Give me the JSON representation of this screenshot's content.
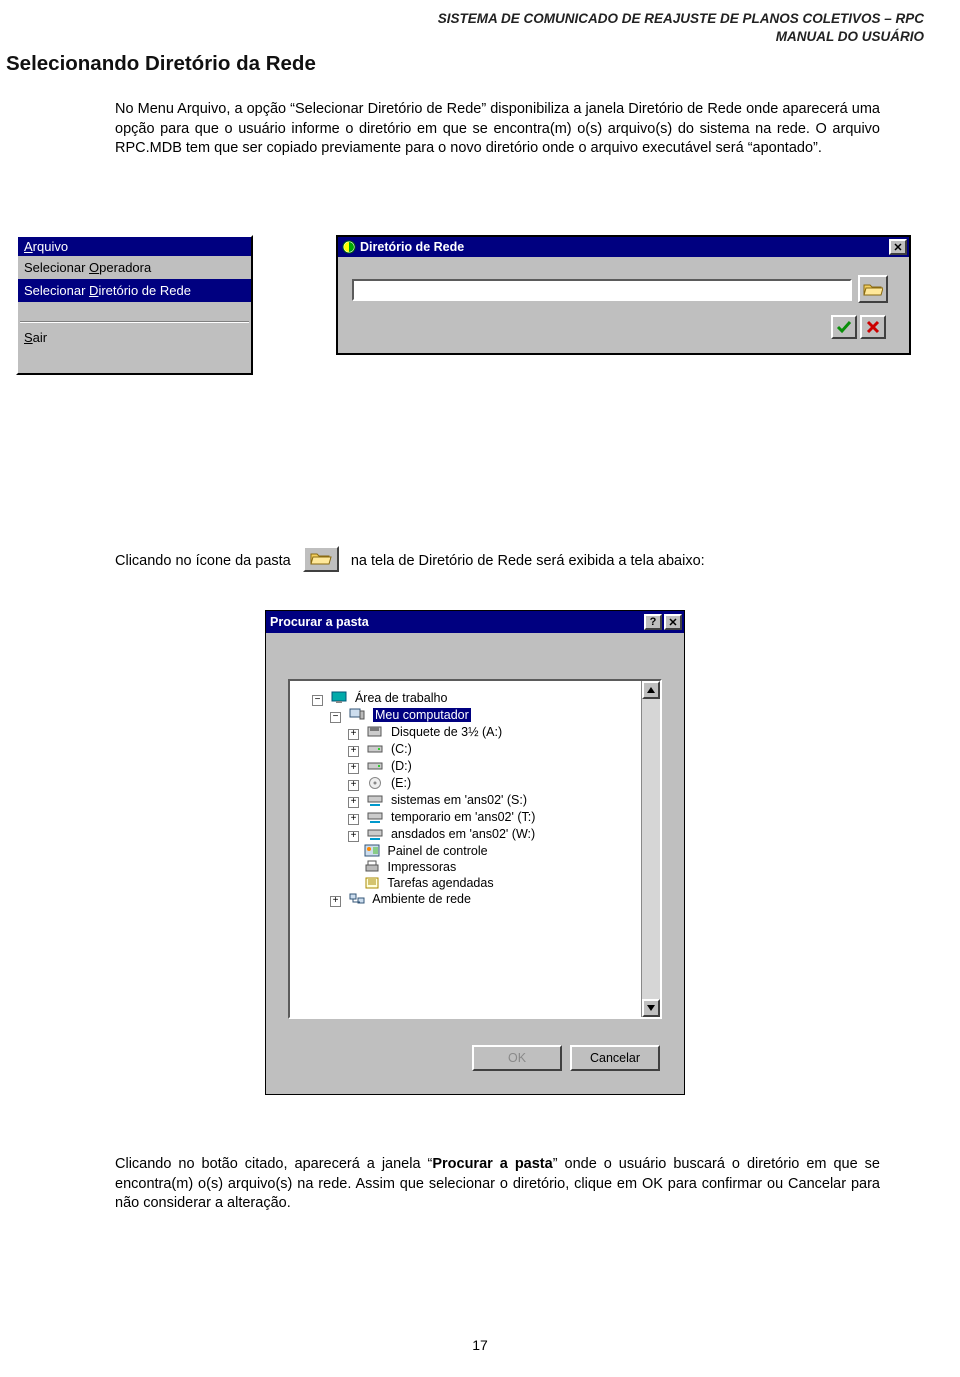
{
  "header": {
    "line1": "SISTEMA DE COMUNICADO DE REAJUSTE DE PLANOS COLETIVOS – RPC",
    "line2": "MANUAL DO USUÁRIO"
  },
  "section_title": "Selecionando Diretório da Rede",
  "paragraph1": "No Menu Arquivo, a opção “Selecionar Diretório de Rede”   disponibiliza a janela Diretório de Rede onde aparecerá uma opção para que o usuário informe o diretório em que se encontra(m) o(s) arquivo(s) do sistema na rede. O arquivo RPC.MDB tem que ser copiado previamente para o novo diretório onde o arquivo executável será “apontado”.",
  "paragraph2_a": "Clicando no ícone da pasta",
  "paragraph2_b": "na tela de Diretório de Rede será exibida a tela abaixo:",
  "paragraph3": "Clicando no botão citado, aparecerá a janela “Procurar a pasta” onde o usuário buscará o diretório em que se encontra(m) o(s) arquivo(s) na rede.  Assim que selecionar o diretório, clique em OK  para confirmar ou Cancelar para não considerar a alteração.",
  "paragraph3_bold": "Procurar a pasta",
  "page_number": "17",
  "menu": {
    "header_html": "<u>A</u>rquivo",
    "item1_html": "Selecionar <u>O</u>peradora",
    "item2_html": "Selecionar <u>D</u>iretório de Rede",
    "item3_html": "<u>S</u>air"
  },
  "dlg1": {
    "title": "Diretório de Rede",
    "path_value": "",
    "icons": {
      "browse": "folder-open-icon",
      "ok": "check-icon",
      "cancel": "x-icon"
    }
  },
  "dlg2": {
    "title": "Procurar a pasta",
    "ok": "OK",
    "cancel": "Cancelar",
    "tree": {
      "n0": "Área de trabalho",
      "n1": "Meu computador",
      "n2": "Disquete de 3½ (A:)",
      "n3": "(C:)",
      "n4": "(D:)",
      "n5": "(E:)",
      "n6": "sistemas em 'ans02' (S:)",
      "n7": "temporario em 'ans02' (T:)",
      "n8": "ansdados em 'ans02' (W:)",
      "n9": "Painel de controle",
      "n10": "Impressoras",
      "n11": "Tarefas agendadas",
      "n12": "Ambiente de rede"
    }
  }
}
